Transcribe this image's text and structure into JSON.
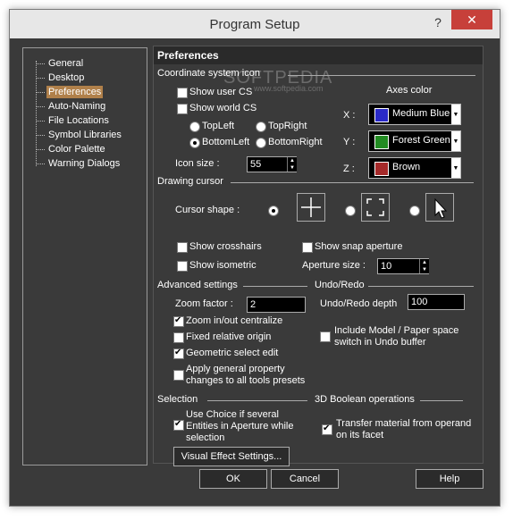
{
  "window": {
    "title": "Program Setup",
    "help_glyph": "?",
    "close_glyph": "✕"
  },
  "tree": {
    "items": [
      "General",
      "Desktop",
      "Preferences",
      "Auto-Naming",
      "File Locations",
      "Symbol Libraries",
      "Color Palette",
      "Warning Dialogs"
    ],
    "selected_index": 2
  },
  "panel": {
    "header": "Preferences"
  },
  "coord": {
    "section": "Coordinate system icon",
    "show_user_cs": "Show user CS",
    "show_world_cs": "Show world CS",
    "top_left": "TopLeft",
    "top_right": "TopRight",
    "bottom_left": "BottomLeft",
    "bottom_right": "BottomRight",
    "icon_size_label": "Icon size :",
    "icon_size_value": "55",
    "axes_color_label": "Axes color",
    "x_label": "X :",
    "x_color_name": "Medium Blue",
    "x_color": "#2a2ac8",
    "y_label": "Y :",
    "y_color_name": "Forest Green",
    "y_color": "#228b22",
    "z_label": "Z :",
    "z_color_name": "Brown",
    "z_color": "#a52a2a"
  },
  "cursor": {
    "section": "Drawing cursor",
    "shape_label": "Cursor shape :",
    "show_crosshairs": "Show crosshairs",
    "show_isometric": "Show isometric",
    "show_snap_aperture": "Show snap aperture",
    "aperture_size_label": "Aperture size :",
    "aperture_size_value": "10"
  },
  "advanced": {
    "section": "Advanced settings",
    "zoom_factor_label": "Zoom factor :",
    "zoom_factor_value": "2",
    "zoom_centralize": "Zoom in/out centralize",
    "fixed_origin": "Fixed relative origin",
    "geometric_select": "Geometric select edit",
    "apply_general_1": "Apply general property",
    "apply_general_2": "changes to all tools presets"
  },
  "undo": {
    "section": "Undo/Redo",
    "depth_label": "Undo/Redo depth",
    "depth_value": "100",
    "include_1": "Include Model / Paper space",
    "include_2": "switch in Undo buffer"
  },
  "selection": {
    "section": "Selection",
    "use_choice_1": "Use Choice if several",
    "use_choice_2": "Entities in Aperture while",
    "use_choice_3": "selection",
    "visual_effect": "Visual Effect Settings..."
  },
  "boolean": {
    "section": "3D Boolean operations",
    "transfer_1": "Transfer material from operand",
    "transfer_2": "on its facet"
  },
  "buttons": {
    "ok": "OK",
    "cancel": "Cancel",
    "help": "Help"
  },
  "watermark": {
    "big": "SOFTPEDIA",
    "small": "www.softpedia.com"
  }
}
